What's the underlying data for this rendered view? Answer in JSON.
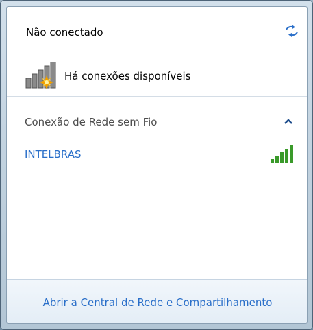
{
  "status": {
    "title": "Não conectado",
    "refresh_icon": "refresh-icon",
    "available_text": "Há conexões disponíveis",
    "available_icon": "signal-warning-icon"
  },
  "section": {
    "label": "Conexão de Rede sem Fio",
    "collapse_icon": "chevron-up-icon"
  },
  "networks": [
    {
      "name": "INTELBRAS",
      "signal_bars": 5,
      "signal_max": 5
    }
  ],
  "footer": {
    "link": "Abrir a Central de Rede e Compartilhamento"
  },
  "colors": {
    "link": "#2a6fc9",
    "signal_green": "#3a9a2a",
    "warning": "#f0a000"
  }
}
